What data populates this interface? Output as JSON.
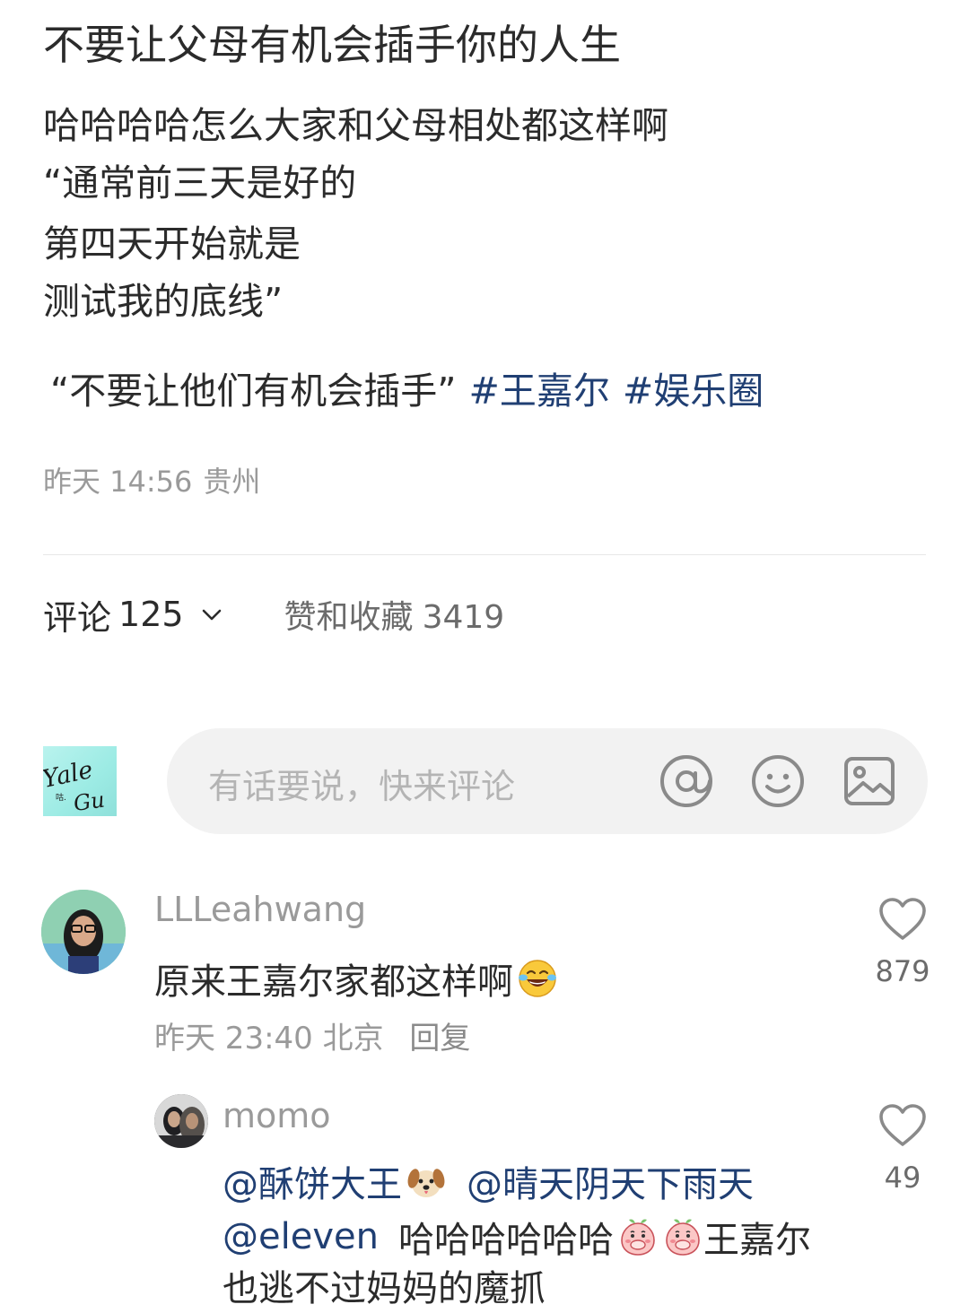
{
  "post": {
    "title": "不要让父母有机会插手你的人生",
    "body_lines": [
      "哈哈哈哈怎么大家和父母相处都这样啊",
      "“通常前三天是好的",
      "第四天开始就是",
      "测试我的底线”"
    ],
    "quote": "“不要让他们有机会插手”",
    "hashtags": [
      "#王嘉尔",
      "#娱乐圈"
    ],
    "date": "昨天 14:56",
    "location": "贵州"
  },
  "tabs": {
    "comments_label": "评论",
    "comments_count": "125",
    "likes_label": "赞和收藏",
    "likes_count": "3419"
  },
  "comment_input": {
    "placeholder": "有话要说，快来评论",
    "avatar_text": "Yale Gu",
    "icons": [
      "at-icon",
      "emoji-icon",
      "image-icon"
    ]
  },
  "comments": [
    {
      "user": "LLLeahwang",
      "text": "原来王嘉尔家都这样啊",
      "emoji": "laughing-tears-emoji",
      "date": "昨天 23:40",
      "location": "北京",
      "reply_label": "回复",
      "likes": "879"
    }
  ],
  "reply": {
    "user": "momo",
    "mention1": "@酥饼大王",
    "mention2": "@晴天阴天下雨天",
    "mention3": "@eleven",
    "text1": "哈哈哈哈哈哈",
    "text2": "王嘉尔",
    "text3": "也逃不过妈妈的魔抓",
    "likes": "49"
  },
  "colors": {
    "text": "#2b2b2b",
    "muted": "#9a9a9a",
    "link": "#203f73",
    "input_bg": "#f2f2f2"
  }
}
